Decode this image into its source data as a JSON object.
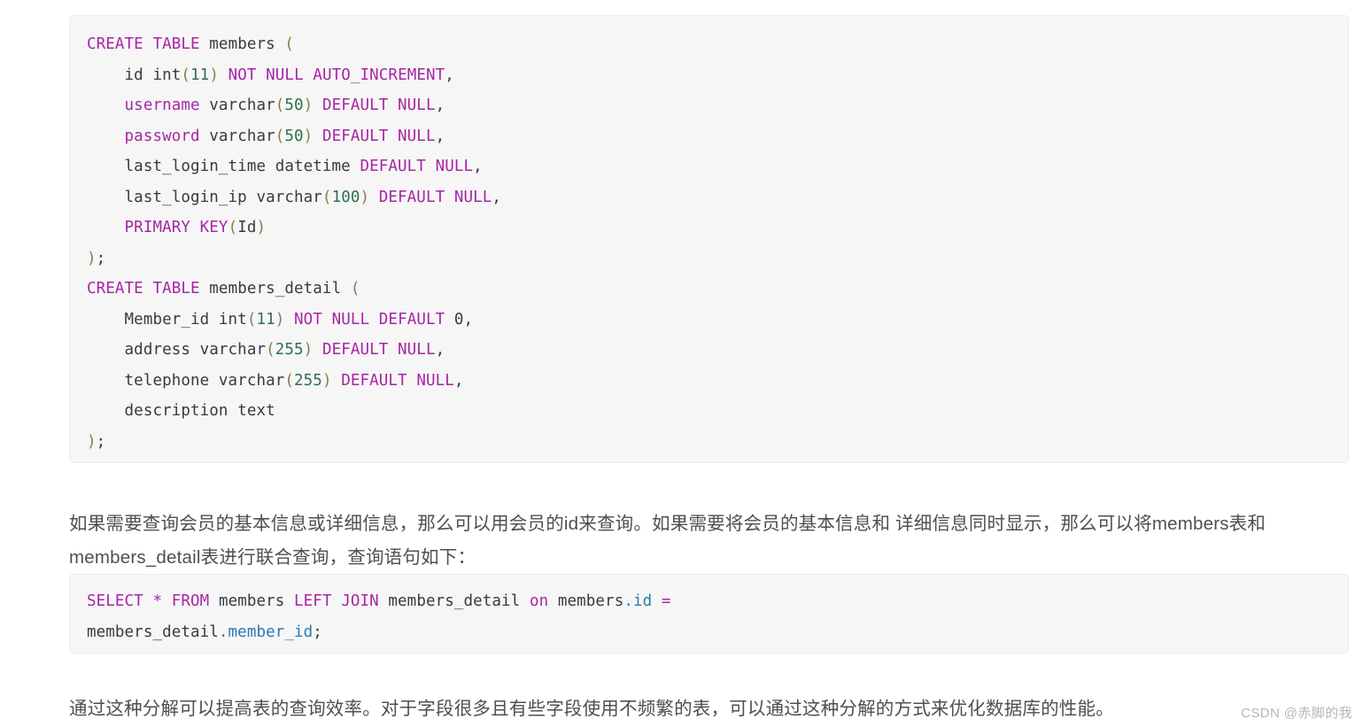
{
  "document": {
    "type": "technical-article-excerpt",
    "language": "zh-CN",
    "background_color": "#ffffff"
  },
  "code_blocks": [
    {
      "id": "create-tables",
      "language": "sql",
      "background_color": "#f6f6f6",
      "plain_text": "CREATE TABLE members (\n    id int(11) NOT NULL AUTO_INCREMENT,\n    username varchar(50) DEFAULT NULL,\n    password varchar(50) DEFAULT NULL,\n    last_login_time datetime DEFAULT NULL,\n    last_login_ip varchar(100) DEFAULT NULL,\n    PRIMARY KEY(Id)\n);\nCREATE TABLE members_detail (\n    Member_id int(11) NOT NULL DEFAULT 0,\n    address varchar(255) DEFAULT NULL,\n    telephone varchar(255) DEFAULT NULL,\n    description text\n);",
      "lines": [
        "CREATE TABLE members (",
        "    id int(11) NOT NULL AUTO_INCREMENT,",
        "    username varchar(50) DEFAULT NULL,",
        "    password varchar(50) DEFAULT NULL,",
        "    last_login_time datetime DEFAULT NULL,",
        "    last_login_ip varchar(100) DEFAULT NULL,",
        "    PRIMARY KEY(Id)",
        ");",
        "CREATE TABLE members_detail (",
        "    Member_id int(11) NOT NULL DEFAULT 0,",
        "    address varchar(255) DEFAULT NULL,",
        "    telephone varchar(255) DEFAULT NULL,",
        "    description text",
        ");"
      ]
    },
    {
      "id": "select-join",
      "language": "sql",
      "background_color": "#f6f6f6",
      "plain_text": "SELECT * FROM members LEFT JOIN members_detail on members.id = members_detail.member_id;",
      "lines": [
        "SELECT * FROM members LEFT JOIN members_detail on members.id =",
        "members_detail.member_id;"
      ]
    }
  ],
  "paragraphs": {
    "intro": "如果需要查询会员的基本信息或详细信息，那么可以用会员的id来查询。如果需要将会员的基本信息和 详细信息同时显示，那么可以将members表和members_detail表进行联合查询，查询语句如下：",
    "outro": "通过这种分解可以提高表的查询效率。对于字段很多且有些字段使用不频繁的表，可以通过这种分解的方式来优化数据库的性能。"
  },
  "watermark": {
    "text": "CSDN @赤脚的我",
    "color": "#b6b6b6"
  },
  "syntax_colors": {
    "keyword": "#a626a4",
    "identifier": "#383a42",
    "number": "#2f6f4e",
    "punctuation": "#8a7b4a",
    "property": "#2a7ab0"
  }
}
